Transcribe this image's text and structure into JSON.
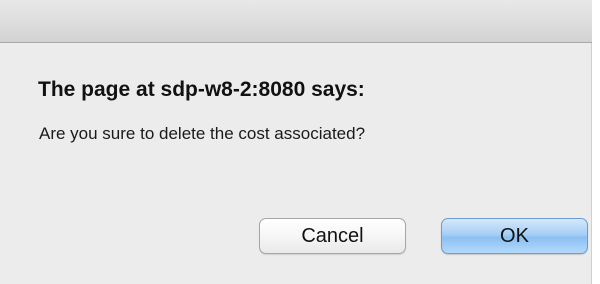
{
  "dialog": {
    "heading": "The page at sdp-w8-2:8080 says:",
    "message": "Are you sure to delete the cost associated?",
    "cancel_label": "Cancel",
    "ok_label": "OK"
  },
  "colors": {
    "dialog_background": "#ececec",
    "default_button_accent": "#a6cff6"
  }
}
